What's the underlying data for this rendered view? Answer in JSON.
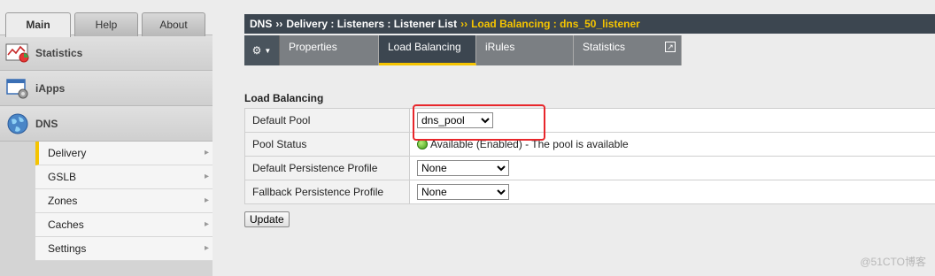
{
  "top_tabs": [
    "Main",
    "Help",
    "About"
  ],
  "nav": {
    "statistics": "Statistics",
    "iapps": "iApps",
    "dns": "DNS",
    "dns_items": [
      "Delivery",
      "GSLB",
      "Zones",
      "Caches",
      "Settings"
    ]
  },
  "breadcrumb": {
    "part1": "DNS",
    "part2": "Delivery : Listeners : Listener List",
    "current": "Load Balancing : dns_50_listener",
    "separator": "››"
  },
  "tabs": [
    "Properties",
    "Load Balancing",
    "iRules",
    "Statistics"
  ],
  "section_title": "Load Balancing",
  "rows": {
    "default_pool_label": "Default Pool",
    "default_pool_value": "dns_pool",
    "pool_status_label": "Pool Status",
    "pool_status_value": "Available (Enabled) - The pool is available",
    "default_persist_label": "Default Persistence Profile",
    "default_persist_value": "None",
    "fallback_persist_label": "Fallback Persistence Profile",
    "fallback_persist_value": "None"
  },
  "update_label": "Update",
  "watermark": "@51CTO博客",
  "colors": {
    "accent": "#f5c400",
    "header_bg": "#3c4650",
    "highlight": "#e8262b",
    "status_green": "#3f9a14"
  }
}
